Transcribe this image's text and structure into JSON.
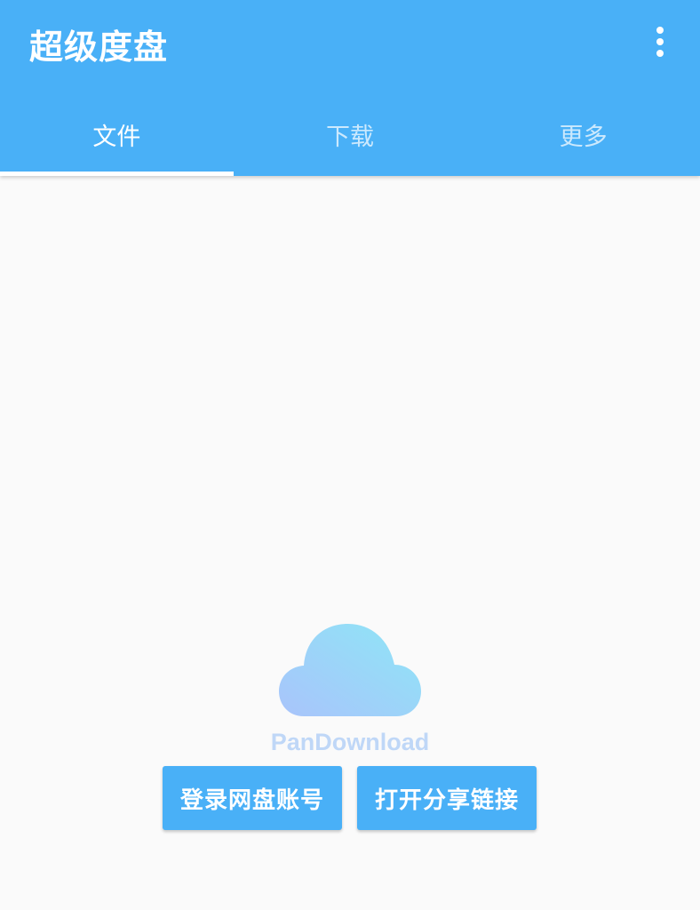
{
  "app": {
    "title": "超级度盘"
  },
  "tabs": [
    {
      "label": "文件",
      "active": true
    },
    {
      "label": "下载",
      "active": false
    },
    {
      "label": "更多",
      "active": false
    }
  ],
  "empty_state": {
    "brand": "PanDownload",
    "logo_icon": "cloud-icon"
  },
  "actions": {
    "login_label": "登录网盘账号",
    "share_label": "打开分享链接"
  },
  "colors": {
    "primary": "#49b0f7",
    "background": "#fafafa",
    "brand_text": "#bfd7f7"
  }
}
